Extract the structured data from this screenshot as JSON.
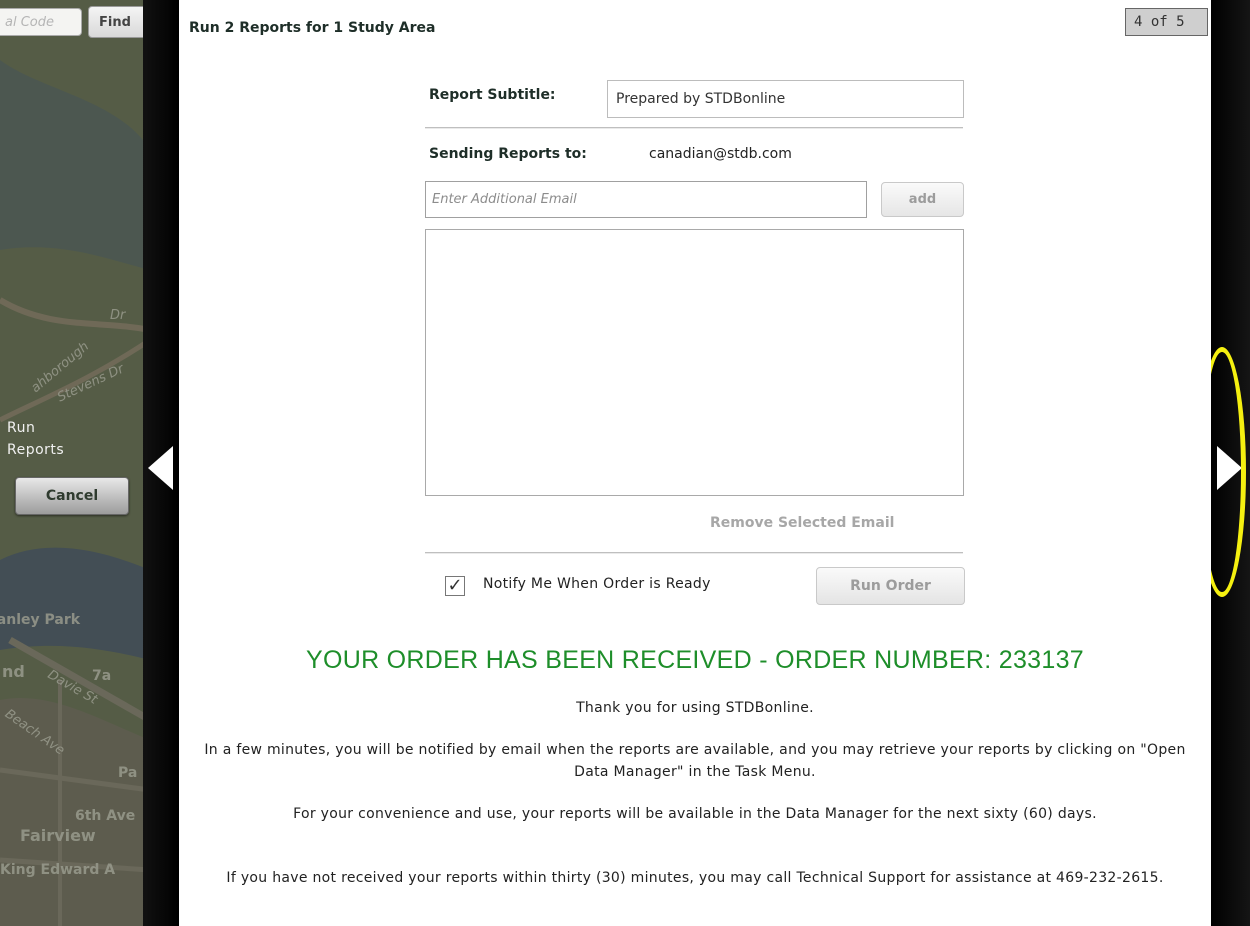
{
  "background": {
    "search_placeholder": "al Code",
    "find_label": "Find",
    "map_labels": [
      "Dr",
      "Stevens Dr",
      "ahborough",
      "Stanley Park",
      "Davie St",
      "Beach Ave",
      "7a",
      "Pa",
      "6th Ave",
      "Fairview",
      "King Edward A",
      "nd"
    ],
    "run_reports_line1": "Run",
    "run_reports_line2": "Reports",
    "cancel_label": "Cancel"
  },
  "dialog": {
    "title": "Run 2 Reports for 1 Study Area",
    "page_counter": "4 of 5",
    "subtitle_label": "Report Subtitle:",
    "subtitle_value": "Prepared by STDBonline",
    "sending_label": "Sending Reports to:",
    "sending_email": "canadian@stdb.com",
    "email_placeholder": "Enter Additional Email",
    "add_label": "add",
    "remove_label": "Remove Selected Email",
    "notify_checked": true,
    "notify_check_glyph": "✓",
    "notify_label": "Notify Me When Order is Ready",
    "run_order_label": "Run Order",
    "order_received": "YOUR ORDER HAS BEEN RECEIVED - ORDER NUMBER: 233137",
    "thank_you": "Thank you for using STDBonline.",
    "para1": "In a few minutes, you will be notified by email when the reports are available, and you may retrieve your reports by clicking on \"Open Data Manager\" in the Task Menu.",
    "para2": "For your convenience and use, your reports will be available in the Data Manager for the next sixty (60) days.",
    "para3": "If you have not received your reports within thirty (30) minutes, you may call Technical Support for assistance at 469-232-2615."
  },
  "navigation": {
    "prev_icon": "triangle-left-icon",
    "next_icon": "triangle-right-icon"
  },
  "colors": {
    "accent_green": "#1e8e2a",
    "highlight_yellow": "#f5f010"
  }
}
